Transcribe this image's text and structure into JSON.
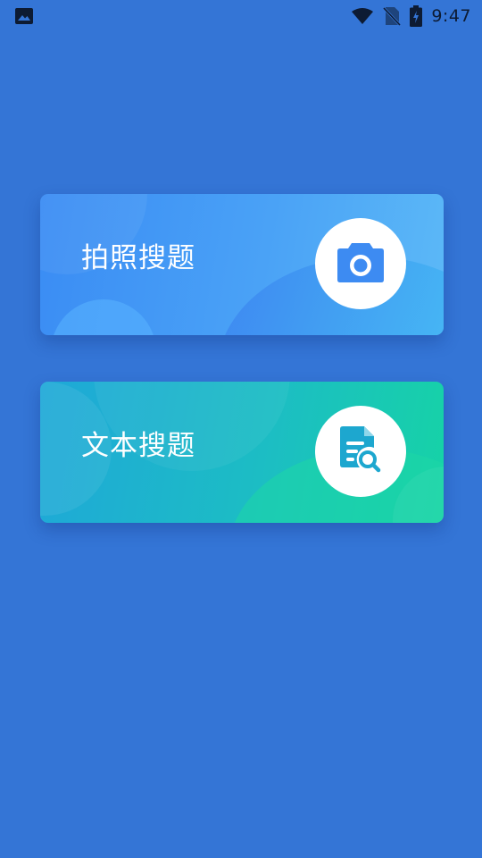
{
  "status_bar": {
    "time": "9:47",
    "icons": [
      "image-notification-icon",
      "wifi-icon",
      "no-sim-icon",
      "battery-charging-icon"
    ]
  },
  "cards": [
    {
      "label": "拍照搜题",
      "icon": "camera-icon",
      "accent": "#3a8cf4"
    },
    {
      "label": "文本搜题",
      "icon": "document-search-icon",
      "accent": "#1fb0c4"
    }
  ],
  "colors": {
    "background": "#3475d6",
    "camera_icon": "#3d8bf2",
    "doc_icon": "#1da7cf"
  }
}
